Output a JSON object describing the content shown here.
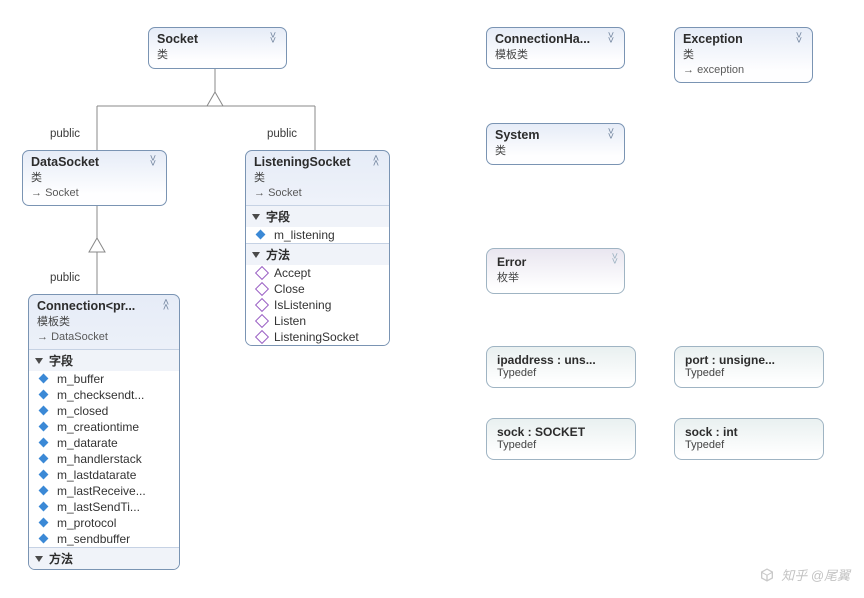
{
  "labels": {
    "public_left": "public",
    "public_right": "public",
    "public_conn": "public"
  },
  "socket": {
    "title": "Socket",
    "sub": "类"
  },
  "datasocket": {
    "title": "DataSocket",
    "sub": "类",
    "inh": "Socket"
  },
  "listening": {
    "title": "ListeningSocket",
    "sub": "类",
    "inh": "Socket",
    "fields_h": "字段",
    "methods_h": "方法",
    "fields": [
      "m_listening"
    ],
    "methods": [
      "Accept",
      "Close",
      "IsListening",
      "Listen",
      "ListeningSocket"
    ]
  },
  "connection": {
    "title": "Connection<pr...",
    "sub": "模板类",
    "inh": "DataSocket",
    "fields_h": "字段",
    "methods_h": "方法",
    "fields": [
      "m_buffer",
      "m_checksendt...",
      "m_closed",
      "m_creationtime",
      "m_datarate",
      "m_handlerstack",
      "m_lastdatarate",
      "m_lastReceive...",
      "m_lastSendTi...",
      "m_protocol",
      "m_sendbuffer"
    ]
  },
  "connectionha": {
    "title": "ConnectionHa...",
    "sub": "模板类"
  },
  "exception": {
    "title": "Exception",
    "sub": "类",
    "inh": "exception"
  },
  "system": {
    "title": "System",
    "sub": "类"
  },
  "error": {
    "title": "Error",
    "sub": "枚举"
  },
  "typedefs": {
    "ipaddress": {
      "title": "ipaddress : uns...",
      "sub": "Typedef"
    },
    "port": {
      "title": "port : unsigne...",
      "sub": "Typedef"
    },
    "sock1": {
      "title": "sock : SOCKET",
      "sub": "Typedef"
    },
    "sock2": {
      "title": "sock : int",
      "sub": "Typedef"
    }
  },
  "watermark": "知乎 @尾翼"
}
